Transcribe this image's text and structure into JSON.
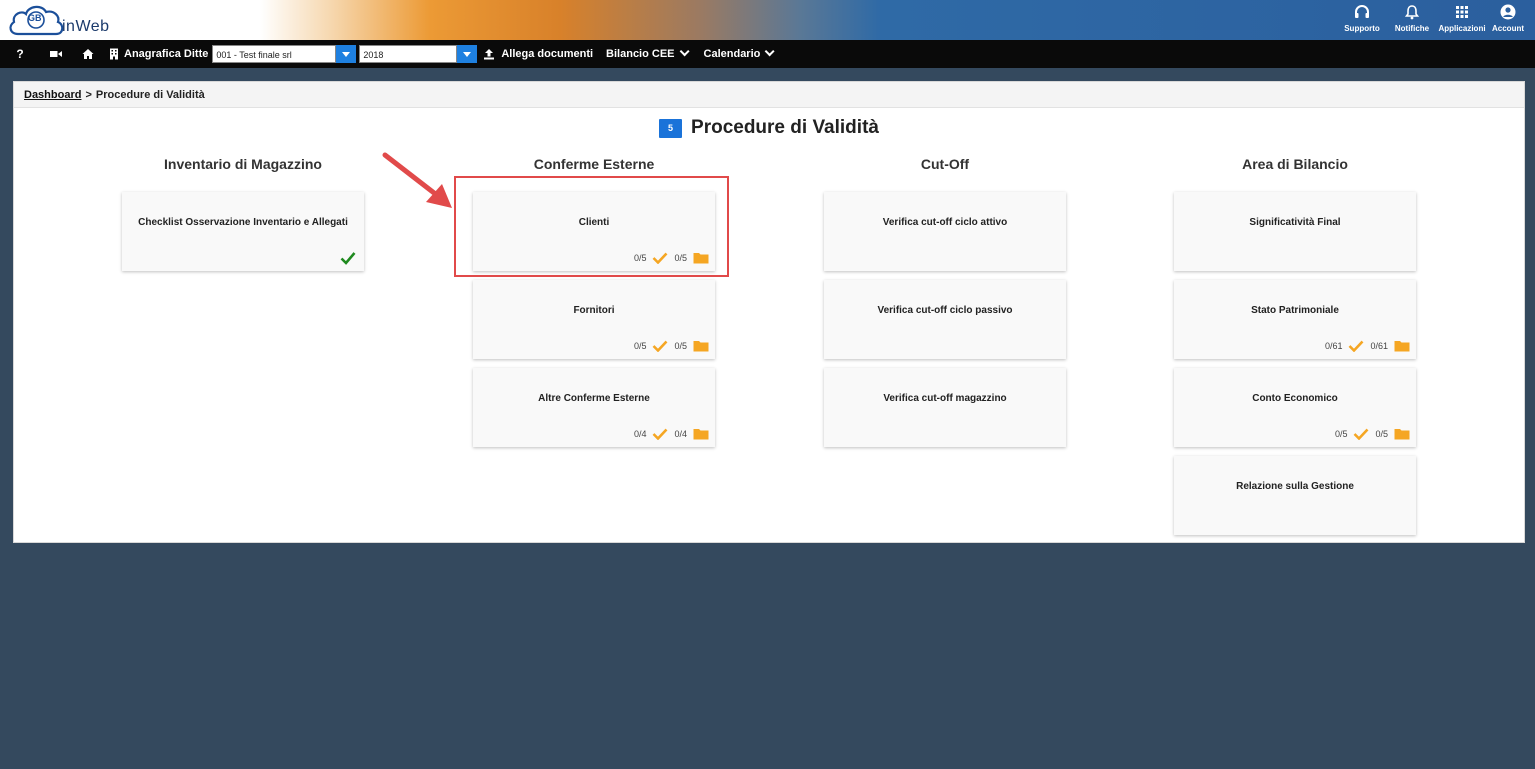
{
  "app": {
    "logo_text": "inWeb",
    "logo_mark": "GB"
  },
  "top_actions": [
    {
      "label": "Supporto",
      "icon": "headset-icon"
    },
    {
      "label": "Notifiche",
      "icon": "bell-icon"
    },
    {
      "label": "Applicazioni",
      "icon": "grid-icon"
    },
    {
      "label": "Account",
      "icon": "user-circle-icon"
    }
  ],
  "navbar": {
    "help_label": "?",
    "anagrafica_label": "Anagrafica Ditte",
    "company_value": "001 - Test finale srl",
    "year_value": "2018",
    "allega_label": "Allega documenti",
    "bilancio_label": "Bilancio CEE",
    "calendario_label": "Calendario"
  },
  "breadcrumb": {
    "home": "Dashboard",
    "separator": ">",
    "current": "Procedure di Validità"
  },
  "page": {
    "badge": "5",
    "title": "Procedure di Validità"
  },
  "columns": [
    {
      "title": "Inventario di Magazzino",
      "cards": [
        {
          "title": "Checklist Osservazione Inventario e Allegati",
          "status": "complete"
        }
      ]
    },
    {
      "title": "Conferme Esterne",
      "cards": [
        {
          "title": "Clienti",
          "done": "0/5",
          "files": "0/5"
        },
        {
          "title": "Fornitori",
          "done": "0/5",
          "files": "0/5"
        },
        {
          "title": "Altre Conferme Esterne",
          "done": "0/4",
          "files": "0/4"
        }
      ]
    },
    {
      "title": "Cut-Off",
      "cards": [
        {
          "title": "Verifica cut-off ciclo attivo"
        },
        {
          "title": "Verifica cut-off ciclo passivo"
        },
        {
          "title": "Verifica cut-off magazzino"
        }
      ]
    },
    {
      "title": "Area di Bilancio",
      "cards": [
        {
          "title": "Significatività Final"
        },
        {
          "title": "Stato Patrimoniale",
          "done": "0/61",
          "files": "0/61"
        },
        {
          "title": "Conto Economico",
          "done": "0/5",
          "files": "0/5"
        },
        {
          "title": "Relazione sulla Gestione"
        }
      ]
    }
  ],
  "colors": {
    "accent_blue": "#1a73d9",
    "check_orange": "#f5a623",
    "folder_orange": "#f5a623",
    "complete_green": "#1f8a1f",
    "highlight_red": "#e14a4a",
    "background": "#34495e"
  }
}
